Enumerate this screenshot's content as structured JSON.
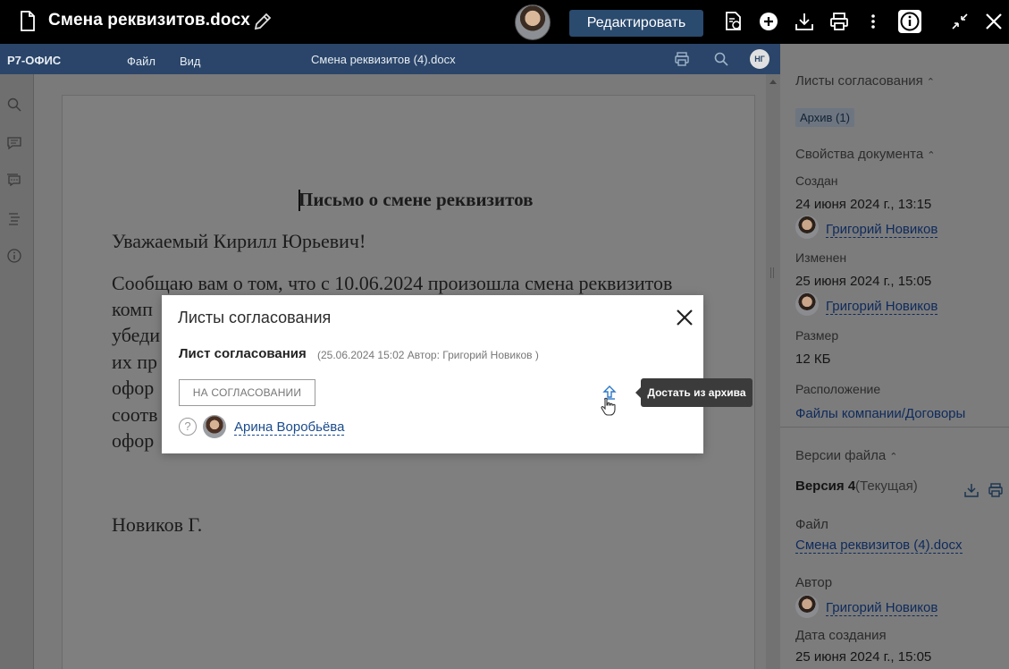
{
  "app": {
    "title": "Смена реквизитов.docx",
    "edit_button": "Редактировать"
  },
  "editor": {
    "brand": "Р7-ОФИС",
    "menu": [
      "Файл",
      "Вид"
    ],
    "doc_name": "Смена реквизитов (4).docx",
    "user_initials": "НГ"
  },
  "document": {
    "heading": "Письмо о смене реквизитов",
    "greeting": "Уважаемый Кирилл Юрьевич!",
    "line1": "Сообщаю вам о том, что с 10.06.2024 произошла смена реквизитов",
    "frag2": "комп",
    "frag3": "убеди",
    "frag4": "их пр",
    "frag5": "офор",
    "frag6": "соотв",
    "frag7": "офор",
    "signature": "Новиков Г."
  },
  "right_panel": {
    "approval_sheets": "Листы согласования",
    "archive_chip": "Архив (1)",
    "doc_props": "Свойства документа",
    "created_label": "Создан",
    "created_value": "24 июня 2024 г., 13:15",
    "created_by": "Григорий Новиков",
    "modified_label": "Изменен",
    "modified_value": "25 июня 2024 г., 15:05",
    "modified_by": "Григорий Новиков",
    "size_label": "Размер",
    "size_value": "12 КБ",
    "location_label": "Расположение",
    "location_value": "Файлы компании/Договоры",
    "versions": "Версии файла",
    "version_bold": "Версия 4",
    "version_current": "(Текущая)",
    "file_label": "Файл",
    "file_value": "Смена реквизитов (4).docx",
    "author_label": "Автор",
    "author_value": "Григорий Новиков",
    "date_label": "Дата создания",
    "date_value": "25 июня 2024 г., 15:05"
  },
  "modal": {
    "title": "Листы согласования",
    "sheet_title": "Лист согласования",
    "sheet_meta": "(25.06.2024 15:02 Автор: Григорий Новиков )",
    "status": "НА СОГЛАСОВАНИИ",
    "approver": "Арина Воробьёва",
    "tooltip": "Достать из архива"
  }
}
